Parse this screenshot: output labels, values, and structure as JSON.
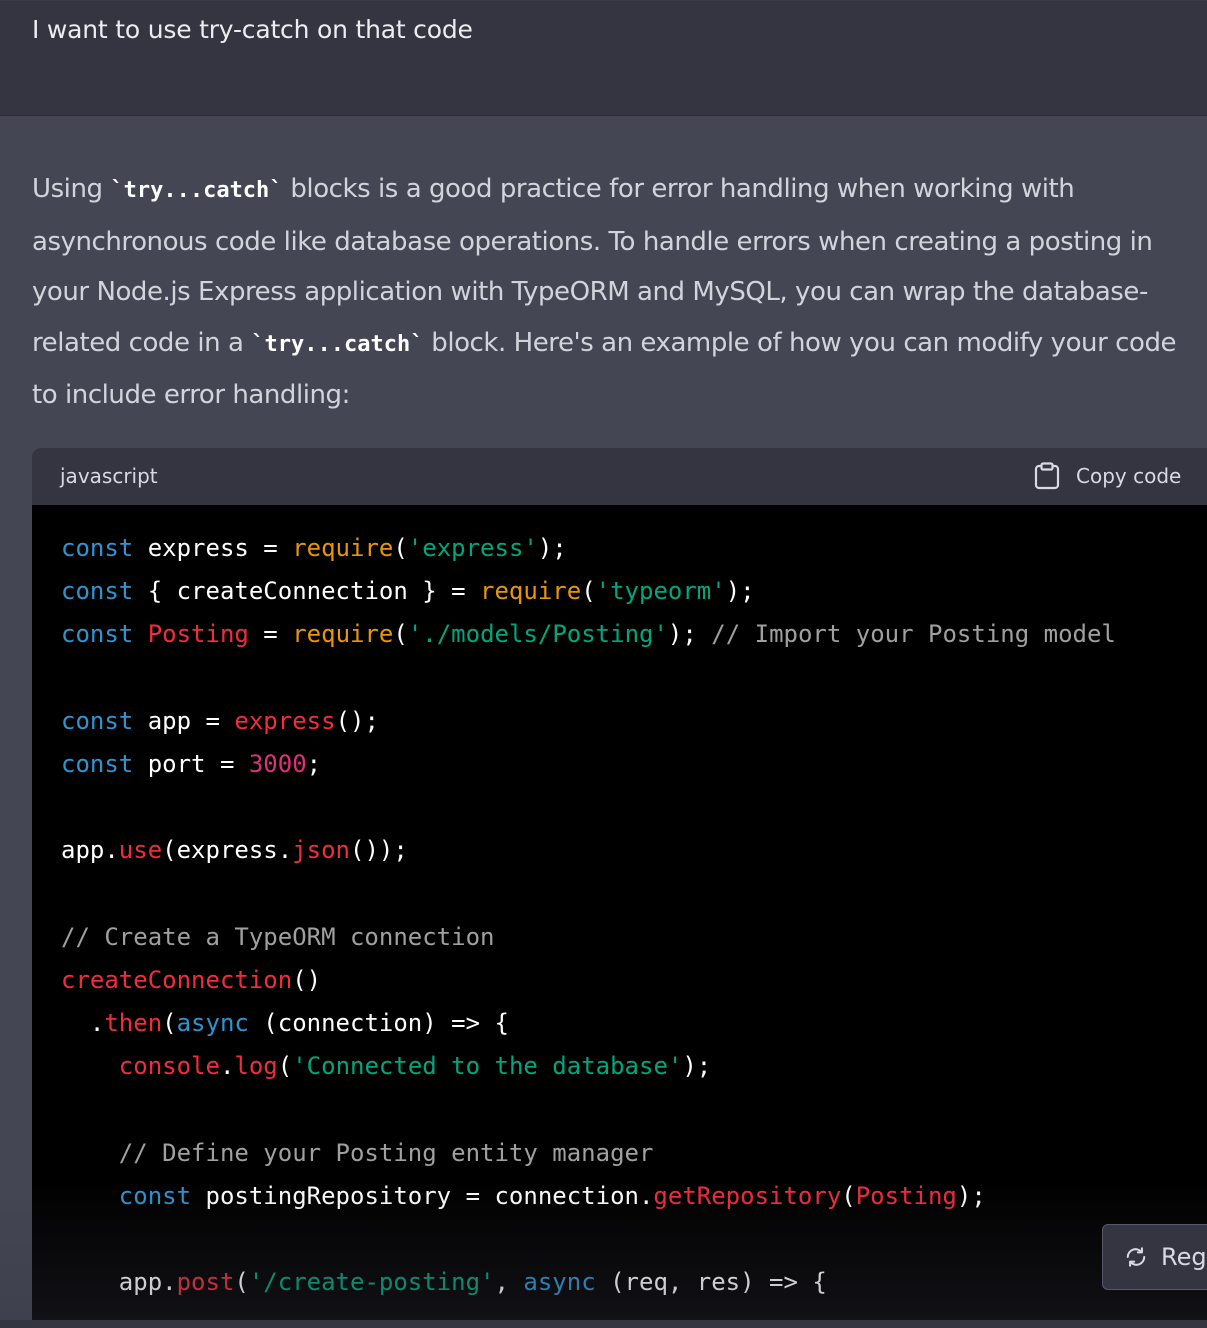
{
  "user_message": "I want to use try-catch on that code",
  "assistant": {
    "paragraph": [
      {
        "t": "text",
        "v": "Using "
      },
      {
        "t": "code",
        "v": "`try...catch`"
      },
      {
        "t": "text",
        "v": " blocks is a good practice for error handling when working with asynchronous code like database operations. To handle errors when creating a posting in your Node.js Express application with TypeORM and MySQL, you can wrap the database-related code in a "
      },
      {
        "t": "code",
        "v": "`try...catch`"
      },
      {
        "t": "text",
        "v": " block. Here's an example of how you can modify your code to include error handling:"
      }
    ],
    "code_block": {
      "language": "javascript",
      "copy_label": "Copy code",
      "lines": [
        [
          [
            "kw",
            "const"
          ],
          [
            "p",
            " express = "
          ],
          [
            "fny",
            "require"
          ],
          [
            "p",
            "("
          ],
          [
            "str",
            "'express'"
          ],
          [
            "p",
            ");"
          ]
        ],
        [
          [
            "kw",
            "const"
          ],
          [
            "p",
            " { createConnection } = "
          ],
          [
            "fny",
            "require"
          ],
          [
            "p",
            "("
          ],
          [
            "str",
            "'typeorm'"
          ],
          [
            "p",
            ");"
          ]
        ],
        [
          [
            "kw",
            "const"
          ],
          [
            "p",
            " "
          ],
          [
            "fn",
            "Posting"
          ],
          [
            "p",
            " = "
          ],
          [
            "fny",
            "require"
          ],
          [
            "p",
            "("
          ],
          [
            "str",
            "'./models/Posting'"
          ],
          [
            "p",
            "); "
          ],
          [
            "cm",
            "// Import your Posting model"
          ]
        ],
        [],
        [
          [
            "kw",
            "const"
          ],
          [
            "p",
            " app = "
          ],
          [
            "fn",
            "express"
          ],
          [
            "p",
            "();"
          ]
        ],
        [
          [
            "kw",
            "const"
          ],
          [
            "p",
            " port = "
          ],
          [
            "num",
            "3000"
          ],
          [
            "p",
            ";"
          ]
        ],
        [],
        [
          [
            "p",
            "app."
          ],
          [
            "fn",
            "use"
          ],
          [
            "p",
            "(express."
          ],
          [
            "fn",
            "json"
          ],
          [
            "p",
            "());"
          ]
        ],
        [],
        [
          [
            "cm",
            "// Create a TypeORM connection"
          ]
        ],
        [
          [
            "fn",
            "createConnection"
          ],
          [
            "p",
            "()"
          ]
        ],
        [
          [
            "p",
            "  ."
          ],
          [
            "fn",
            "then"
          ],
          [
            "p",
            "("
          ],
          [
            "kw",
            "async"
          ],
          [
            "p",
            " (connection) => {"
          ]
        ],
        [
          [
            "p",
            "    "
          ],
          [
            "fn",
            "console"
          ],
          [
            "p",
            "."
          ],
          [
            "fn",
            "log"
          ],
          [
            "p",
            "("
          ],
          [
            "str",
            "'Connected to the database'"
          ],
          [
            "p",
            ");"
          ]
        ],
        [],
        [
          [
            "p",
            "    "
          ],
          [
            "cm",
            "// Define your Posting entity manager"
          ]
        ],
        [
          [
            "p",
            "    "
          ],
          [
            "kw",
            "const"
          ],
          [
            "p",
            " postingRepository = connection."
          ],
          [
            "fn",
            "getRepository"
          ],
          [
            "p",
            "("
          ],
          [
            "fn",
            "Posting"
          ],
          [
            "p",
            ");"
          ]
        ],
        [],
        [
          [
            "p",
            "    app."
          ],
          [
            "fn",
            "post"
          ],
          [
            "p",
            "("
          ],
          [
            "str",
            "'/create-posting'"
          ],
          [
            "p",
            ", "
          ],
          [
            "kw",
            "async"
          ],
          [
            "p",
            " (req, res) => {"
          ]
        ]
      ]
    }
  },
  "regenerate_label": "Regenerate response"
}
